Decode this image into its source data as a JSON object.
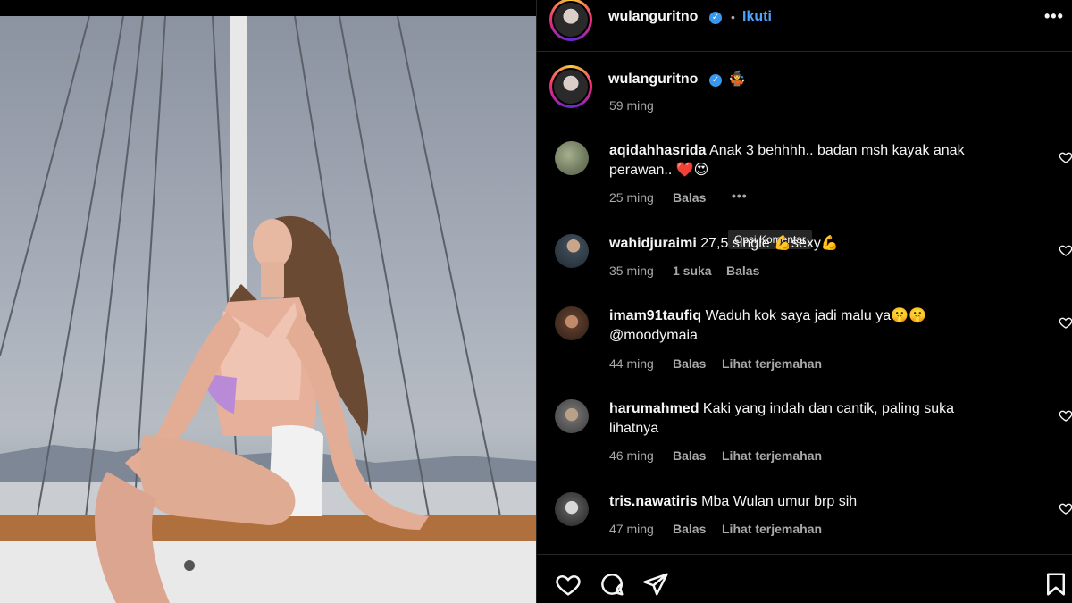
{
  "post": {
    "author": "wulanguritno",
    "follow_label": "Ikuti",
    "dot": "•",
    "more_label": "•••",
    "caption_emoji": "🤹",
    "caption_time": "59 ming"
  },
  "tooltip": "Opsi Komentar",
  "comments": [
    {
      "user": "aqidahhasrida",
      "text": "Anak 3 behhhh.. badan msh kayak anak perawan.. ❤️😍",
      "time": "25 ming",
      "likes": "",
      "reply": "Balas",
      "translate": "",
      "options": "•••"
    },
    {
      "user": "wahidjuraimi",
      "text": "27,5 single 💪sexy💪",
      "time": "35 ming",
      "likes": "1 suka",
      "reply": "Balas",
      "translate": ""
    },
    {
      "user": "imam91taufiq",
      "text": "Waduh kok saya jadi malu ya🤫🤫 @moodymaia",
      "time": "44 ming",
      "likes": "",
      "reply": "Balas",
      "translate": "Lihat terjemahan"
    },
    {
      "user": "harumahmed",
      "text": "Kaki yang indah dan cantik, paling suka lihatnya",
      "time": "46 ming",
      "likes": "",
      "reply": "Balas",
      "translate": "Lihat terjemahan"
    },
    {
      "user": "tris.nawatiris",
      "text": "Mba Wulan umur brp sih",
      "time": "47 ming",
      "likes": "",
      "reply": "Balas",
      "translate": "Lihat terjemahan"
    }
  ],
  "icons": {
    "like": "heart-icon",
    "comment": "comment-icon",
    "share": "send-icon",
    "save": "bookmark-icon"
  }
}
